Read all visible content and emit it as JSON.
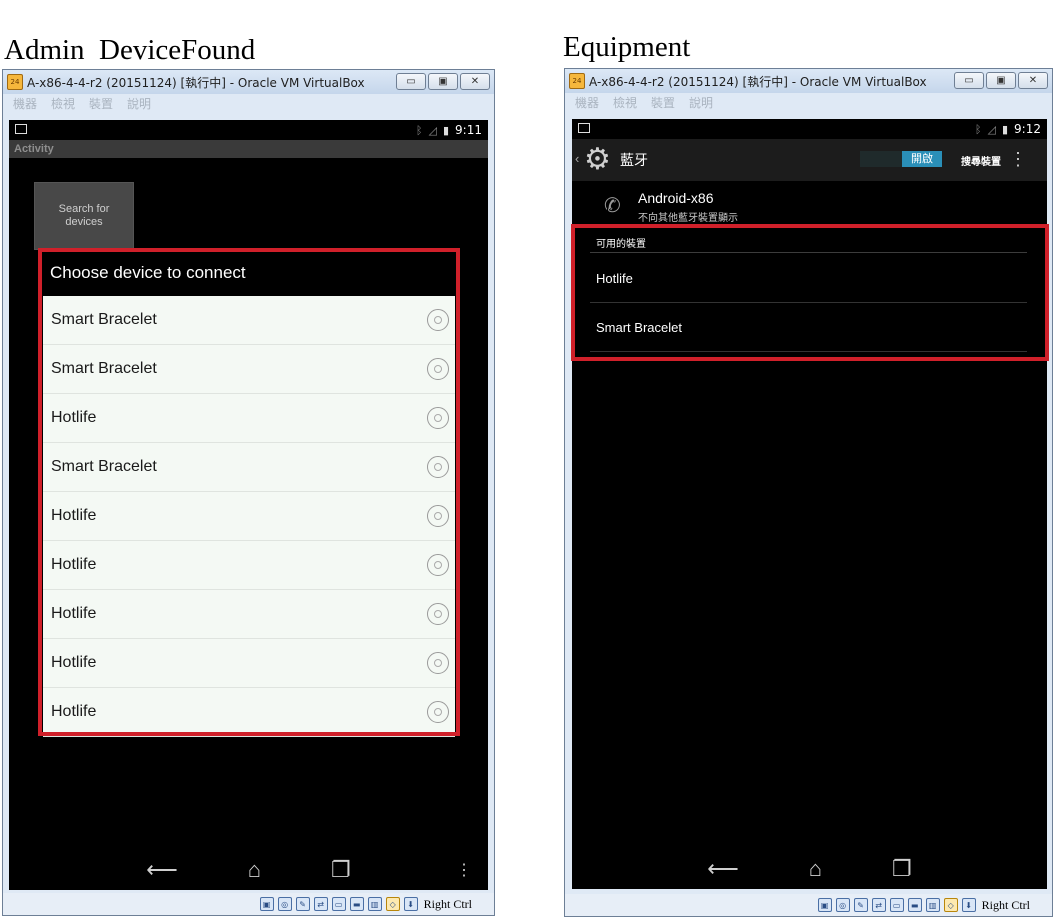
{
  "captions": {
    "left": "Admin  DeviceFound",
    "right": "Equipment"
  },
  "window": {
    "title_left": "A-x86-4-4-r2 (20151124) [執行中] - Oracle VM VirtualBox",
    "title_right": "A-x86-4-4-r2 (20151124) [執行中] - Oracle VM VirtualBox",
    "app_icon_text": "24",
    "menu": [
      "機器",
      "檢視",
      "裝置",
      "說明"
    ],
    "minimize_glyph": "▭",
    "maximize_glyph": "▣",
    "close_glyph": "✕",
    "host_key": "Right Ctrl"
  },
  "left_screen": {
    "time": "9:11",
    "action_bar_title": "Activity",
    "search_button": "Search for devices",
    "dialog_title": "Choose device to connect",
    "devices": [
      "Smart Bracelet",
      "Smart Bracelet",
      "Hotlife",
      "Smart Bracelet",
      "Hotlife",
      "Hotlife",
      "Hotlife",
      "Hotlife",
      "Hotlife"
    ]
  },
  "right_screen": {
    "time": "9:12",
    "title": "藍牙",
    "toggle_label": "開啟",
    "scan_label": "搜尋裝置",
    "device_name": "Android-x86",
    "device_sub": "不向其他藍牙裝置顯示",
    "section_title": "可用的裝置",
    "available_devices": [
      "Hotlife",
      "Smart Bracelet"
    ]
  },
  "icons": {
    "nav": [
      "back-icon",
      "home-icon",
      "recents-icon",
      "menu-icon"
    ],
    "status": [
      "bluetooth-icon",
      "signal-icon",
      "battery-icon"
    ]
  },
  "colors": {
    "highlight_border": "#d0202a",
    "toggle_on": "#2a8fb8"
  }
}
